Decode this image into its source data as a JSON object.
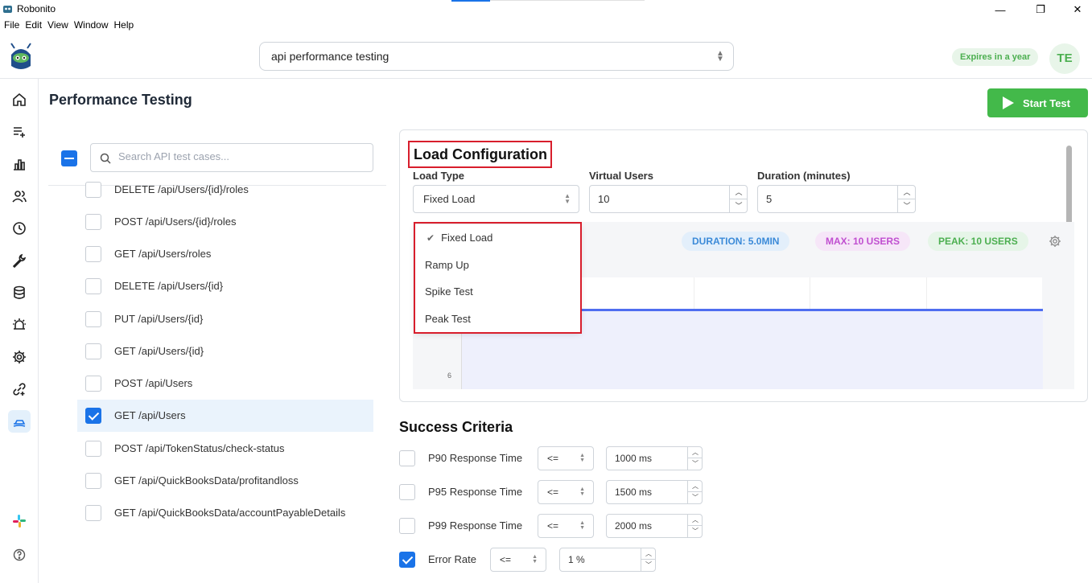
{
  "window": {
    "title": "Robonito",
    "minimize": "—",
    "restore": "❐",
    "close": "✕"
  },
  "menu": [
    "File",
    "Edit",
    "View",
    "Window",
    "Help"
  ],
  "header": {
    "project": "api performance testing",
    "expires": "Expires in a year",
    "avatar": "TE"
  },
  "page": {
    "title": "Performance Testing",
    "start_button": "Start Test",
    "search_placeholder": "Search API test cases..."
  },
  "tests": [
    {
      "label": "DELETE /api/Users/{id}/roles",
      "checked": false
    },
    {
      "label": "POST /api/Users/{id}/roles",
      "checked": false
    },
    {
      "label": "GET /api/Users/roles",
      "checked": false
    },
    {
      "label": "DELETE /api/Users/{id}",
      "checked": false
    },
    {
      "label": "PUT /api/Users/{id}",
      "checked": false
    },
    {
      "label": "GET /api/Users/{id}",
      "checked": false
    },
    {
      "label": "POST /api/Users",
      "checked": false
    },
    {
      "label": "GET /api/Users",
      "checked": true
    },
    {
      "label": "POST /api/TokenStatus/check-status",
      "checked": false
    },
    {
      "label": "GET /api/QuickBooksData/profitandloss",
      "checked": false
    },
    {
      "label": "GET /api/QuickBooksData/accountPayableDetails",
      "checked": false
    }
  ],
  "load_config": {
    "title": "Load Configuration",
    "load_type_label": "Load Type",
    "load_type_value": "Fixed Load",
    "virtual_users_label": "Virtual Users",
    "virtual_users_value": "10",
    "duration_label": "Duration (minutes)",
    "duration_value": "5",
    "dropdown_options": [
      "Fixed Load",
      "Ramp Up",
      "Spike Test",
      "Peak Test"
    ],
    "selected_option": "Fixed Load",
    "stats": {
      "duration": "DURATION: 5.0MIN",
      "max": "MAX: 10 USERS",
      "peak": "PEAK: 10 USERS"
    },
    "axis_tick": "6"
  },
  "success_criteria": {
    "title": "Success Criteria",
    "rows": [
      {
        "name": "P90 Response Time",
        "op": "<=",
        "value": "1000 ms",
        "checked": false
      },
      {
        "name": "P95 Response Time",
        "op": "<=",
        "value": "1500 ms",
        "checked": false
      },
      {
        "name": "P99 Response Time",
        "op": "<=",
        "value": "2000 ms",
        "checked": false
      },
      {
        "name": "Error Rate",
        "op": "<=",
        "value": "1 %",
        "checked": true
      }
    ]
  },
  "colors": {
    "accent": "#1a73e8",
    "start_green": "#43b94a",
    "highlight_red": "#d81e2c",
    "duration_pill": "#e3effb",
    "max_pill": "#f6e6f8",
    "peak_pill": "#e6f5e8"
  },
  "icons": [
    "home-icon",
    "playlist-add-icon",
    "bar-chart-icon",
    "users-icon",
    "clock-icon",
    "wrench-icon",
    "database-icon",
    "alarm-icon",
    "settings-icon",
    "link-icon",
    "performance-icon",
    "slack-icon",
    "help-icon"
  ]
}
